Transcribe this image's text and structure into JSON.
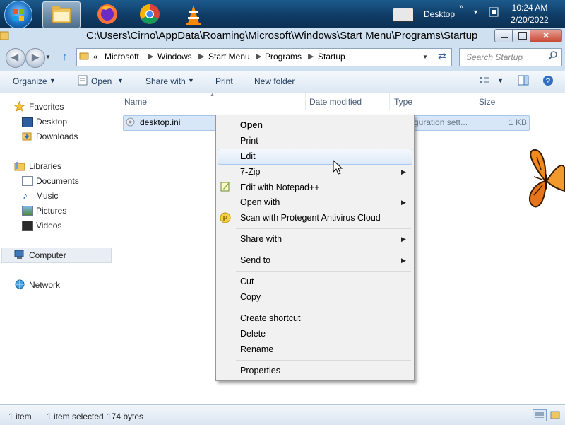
{
  "taskbar": {
    "apps": [
      "windows-explorer",
      "firefox",
      "chrome",
      "vlc"
    ],
    "desktop_label": "Desktop",
    "show_hidden_label": "»",
    "clock_time": "10:24 AM",
    "clock_date": "2/20/2022"
  },
  "window": {
    "title_path": "C:\\Users\\Cirno\\AppData\\Roaming\\Microsoft\\Windows\\Start Menu\\Programs\\Startup",
    "close_label": "✕"
  },
  "address": {
    "overflow": "«",
    "crumbs": [
      "Microsoft",
      "Windows",
      "Start Menu",
      "Programs",
      "Startup"
    ],
    "search_placeholder": "Search Startup"
  },
  "toolbar": {
    "organize": "Organize",
    "open": "Open",
    "share_with": "Share with",
    "print": "Print",
    "new_folder": "New folder"
  },
  "nav": {
    "favorites": "Favorites",
    "favorites_items": [
      "Desktop",
      "Downloads"
    ],
    "libraries": "Libraries",
    "libraries_items": [
      "Documents",
      "Music",
      "Pictures",
      "Videos"
    ],
    "computer": "Computer",
    "network": "Network"
  },
  "columns": {
    "name": "Name",
    "date_modified": "Date modified",
    "type": "Type",
    "size": "Size"
  },
  "files": [
    {
      "name": "desktop.ini",
      "type": "guration sett...",
      "size": "1 KB"
    }
  ],
  "context_menu": {
    "open": "Open",
    "print": "Print",
    "edit": "Edit",
    "seven_zip": "7-Zip",
    "edit_notepadpp": "Edit with Notepad++",
    "open_with": "Open with",
    "scan_protegent": "Scan with Protegent Antivirus Cloud",
    "share_with": "Share with",
    "send_to": "Send to",
    "cut": "Cut",
    "copy": "Copy",
    "create_shortcut": "Create shortcut",
    "delete": "Delete",
    "rename": "Rename",
    "properties": "Properties"
  },
  "status": {
    "item_count": "1 item",
    "selected": "1 item selected",
    "size": "174 bytes"
  },
  "colors": {
    "taskbar": "#0f3c66",
    "selection": "#d7e7f8",
    "menu_bg": "#f1f1f1"
  }
}
